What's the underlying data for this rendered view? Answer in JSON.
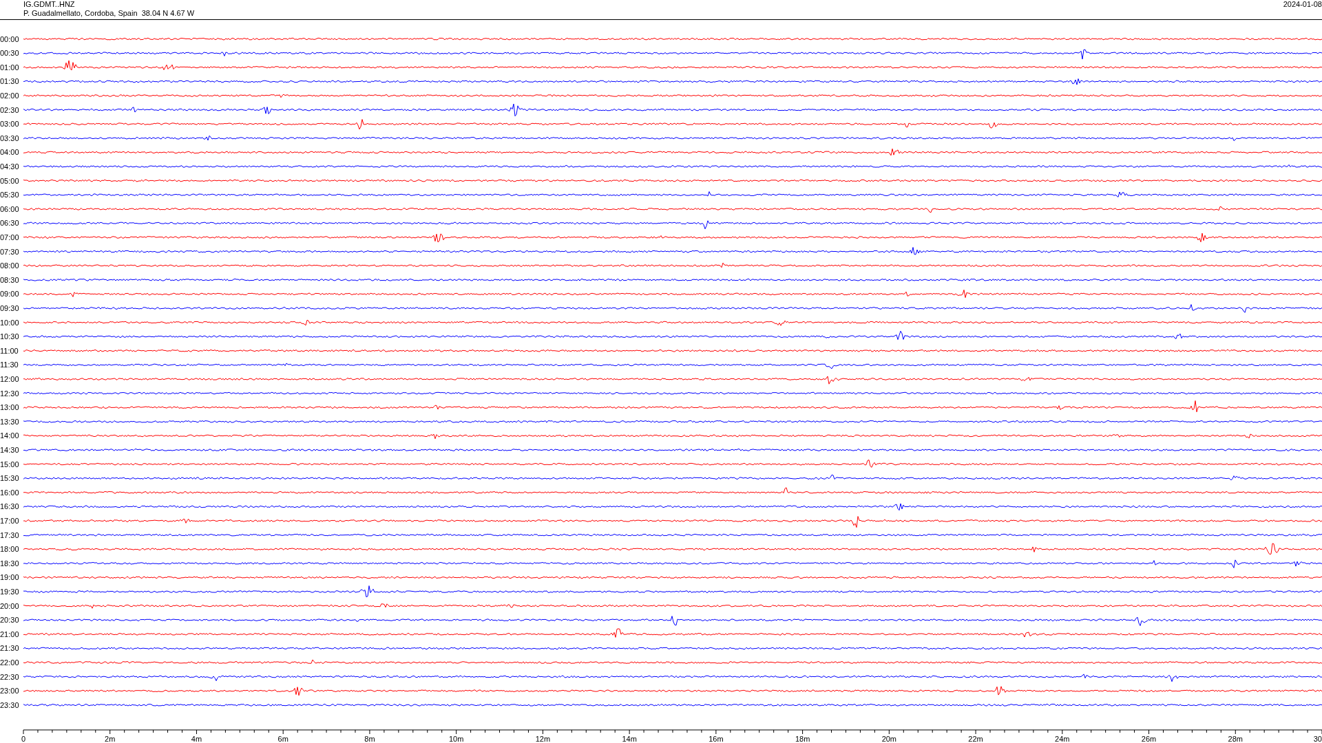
{
  "header": {
    "station": "IG.GDMT..HNZ",
    "location": "P. Guadalmellato, Cordoba, Spain  38.04 N 4.67 W",
    "date": "2024-01-08"
  },
  "rows": [
    {
      "label": "00:00",
      "color": "#ff0000"
    },
    {
      "label": "00:30",
      "color": "#0000ff"
    },
    {
      "label": "01:00",
      "color": "#ff0000"
    },
    {
      "label": "01:30",
      "color": "#0000ff"
    },
    {
      "label": "02:00",
      "color": "#ff0000"
    },
    {
      "label": "02:30",
      "color": "#0000ff"
    },
    {
      "label": "03:00",
      "color": "#ff0000"
    },
    {
      "label": "03:30",
      "color": "#0000ff"
    },
    {
      "label": "04:00",
      "color": "#ff0000"
    },
    {
      "label": "04:30",
      "color": "#0000ff"
    },
    {
      "label": "05:00",
      "color": "#ff0000"
    },
    {
      "label": "05:30",
      "color": "#0000ff"
    },
    {
      "label": "06:00",
      "color": "#ff0000"
    },
    {
      "label": "06:30",
      "color": "#0000ff"
    },
    {
      "label": "07:00",
      "color": "#ff0000"
    },
    {
      "label": "07:30",
      "color": "#0000ff"
    },
    {
      "label": "08:00",
      "color": "#ff0000"
    },
    {
      "label": "08:30",
      "color": "#0000ff"
    },
    {
      "label": "09:00",
      "color": "#ff0000"
    },
    {
      "label": "09:30",
      "color": "#0000ff"
    },
    {
      "label": "10:00",
      "color": "#ff0000"
    },
    {
      "label": "10:30",
      "color": "#0000ff"
    },
    {
      "label": "11:00",
      "color": "#ff0000"
    },
    {
      "label": "11:30",
      "color": "#0000ff"
    },
    {
      "label": "12:00",
      "color": "#ff0000"
    },
    {
      "label": "12:30",
      "color": "#0000ff"
    },
    {
      "label": "13:00",
      "color": "#ff0000"
    },
    {
      "label": "13:30",
      "color": "#0000ff"
    },
    {
      "label": "14:00",
      "color": "#ff0000"
    },
    {
      "label": "14:30",
      "color": "#0000ff"
    },
    {
      "label": "15:00",
      "color": "#ff0000"
    },
    {
      "label": "15:30",
      "color": "#0000ff"
    },
    {
      "label": "16:00",
      "color": "#ff0000"
    },
    {
      "label": "16:30",
      "color": "#0000ff"
    },
    {
      "label": "17:00",
      "color": "#ff0000"
    },
    {
      "label": "17:30",
      "color": "#0000ff"
    },
    {
      "label": "18:00",
      "color": "#ff0000"
    },
    {
      "label": "18:30",
      "color": "#0000ff"
    },
    {
      "label": "19:00",
      "color": "#ff0000"
    },
    {
      "label": "19:30",
      "color": "#0000ff"
    },
    {
      "label": "20:00",
      "color": "#ff0000"
    },
    {
      "label": "20:30",
      "color": "#0000ff"
    },
    {
      "label": "21:00",
      "color": "#ff0000"
    },
    {
      "label": "21:30",
      "color": "#0000ff"
    },
    {
      "label": "22:00",
      "color": "#ff0000"
    },
    {
      "label": "22:30",
      "color": "#0000ff"
    },
    {
      "label": "23:00",
      "color": "#ff0000"
    },
    {
      "label": "23:30",
      "color": "#0000ff"
    }
  ],
  "axis": {
    "ticks": [
      "0",
      "2m",
      "4m",
      "6m",
      "8m",
      "10m",
      "12m",
      "14m",
      "16m",
      "18m",
      "20m",
      "22m",
      "24m",
      "26m",
      "28m",
      "30"
    ]
  }
}
